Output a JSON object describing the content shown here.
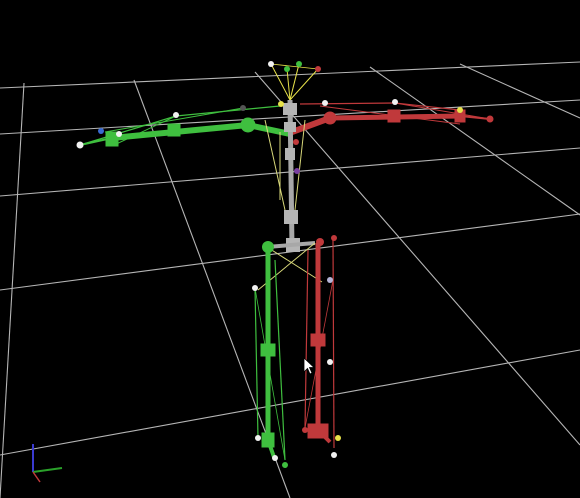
{
  "app": {
    "view": "3D viewport",
    "background": "#000000"
  },
  "colors": {
    "grid": "#bfbfbf",
    "left_side": "#3fbf3f",
    "right_side": "#c0393b",
    "spine": "#a8a8a8",
    "marker_white": "#f2f2f2",
    "marker_yellow": "#e8e24a",
    "axis_x": "#2aa12a",
    "axis_y": "#3a3ad0"
  },
  "icons": {
    "axis_gizmo": "axis-gizmo-icon",
    "cursor": "mouse-pointer-icon"
  }
}
